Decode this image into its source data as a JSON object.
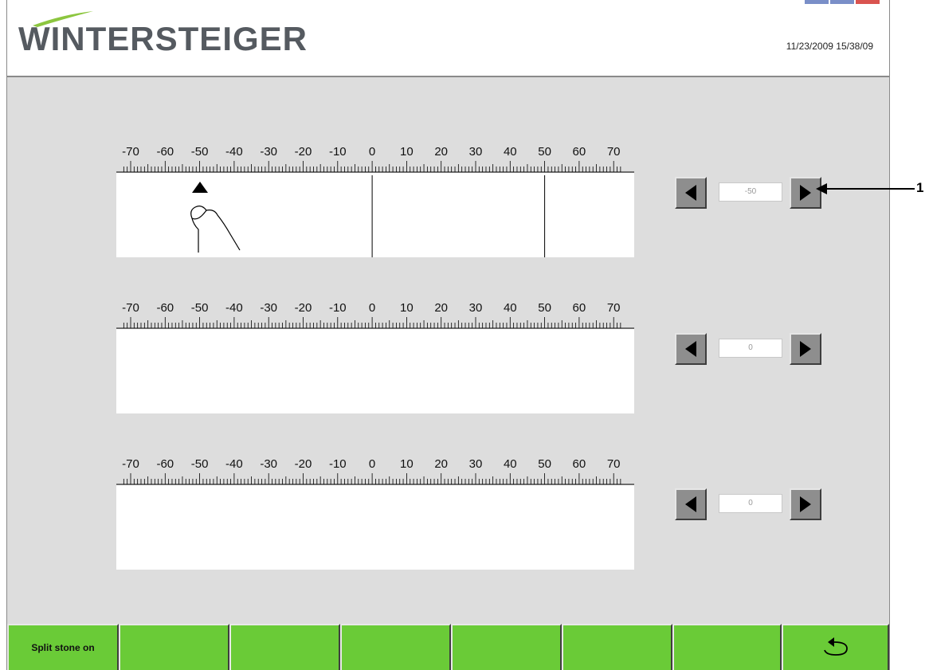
{
  "header": {
    "brand": "WINTERSTEIGER",
    "datetime": "11/23/2009 15/38/09"
  },
  "scale_labels": [
    "-70",
    "-60",
    "-50",
    "-40",
    "-30",
    "-20",
    "-10",
    "0",
    "10",
    "20",
    "30",
    "40",
    "50",
    "60",
    "70"
  ],
  "rows": [
    {
      "value": "-50",
      "marker_value": -50,
      "guide_values": [
        0,
        50
      ]
    },
    {
      "value": "0"
    },
    {
      "value": "0"
    }
  ],
  "callout": {
    "label": "1"
  },
  "footer": {
    "keys": [
      "Split stone on",
      "",
      "",
      "",
      "",
      "",
      "",
      ""
    ],
    "back_icon": "undo-arrow-icon"
  },
  "colors": {
    "function_key": "#6acb37",
    "background": "#dddddd",
    "arrow_button": "#8e8e8e",
    "brand_accent": "#8cc63f"
  }
}
